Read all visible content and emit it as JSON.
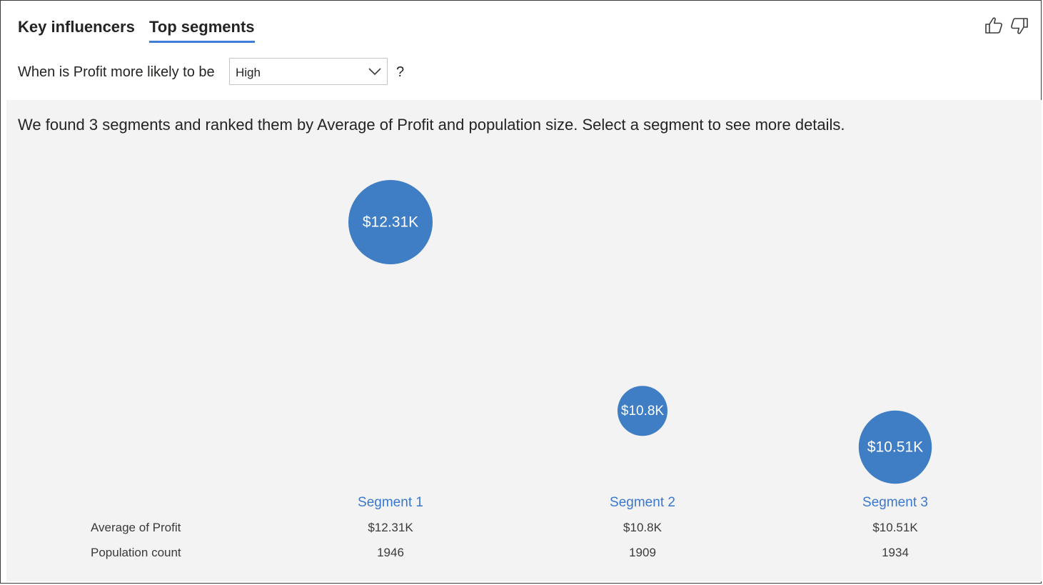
{
  "tabs": [
    {
      "label": "Key influencers",
      "active": false
    },
    {
      "label": "Top segments",
      "active": true
    }
  ],
  "feedback": {
    "thumbs_up_icon": "thumbs-up-icon",
    "thumbs_down_icon": "thumbs-down-icon"
  },
  "question": {
    "prefix": "When is Profit more likely to be",
    "selected": "High",
    "suffix": "?"
  },
  "summary": "We found 3 segments and ranked them by Average of Profit and population size. Select a segment to see more details.",
  "colors": {
    "accent": "#3f7dd8",
    "bubble": "#3f7dc5",
    "segment_link": "#3a78d0",
    "panel_bg": "#f3f3f3"
  },
  "table": {
    "row_labels": [
      "Average of Profit",
      "Population count"
    ]
  },
  "chart_data": {
    "type": "scatter",
    "title": "",
    "xlabel": "",
    "ylabel": "",
    "segments": [
      {
        "name": "Segment 1",
        "label": "$12.31K",
        "avg_profit": 12.31,
        "population": 1946,
        "profit_text": "$12.31K",
        "population_text": "1946"
      },
      {
        "name": "Segment 2",
        "label": "$10.8K",
        "avg_profit": 10.8,
        "population": 1909,
        "profit_text": "$10.8K",
        "population_text": "1909"
      },
      {
        "name": "Segment 3",
        "label": "$10.51K",
        "avg_profit": 10.51,
        "population": 1934,
        "profit_text": "$10.51K",
        "population_text": "1934"
      }
    ]
  }
}
